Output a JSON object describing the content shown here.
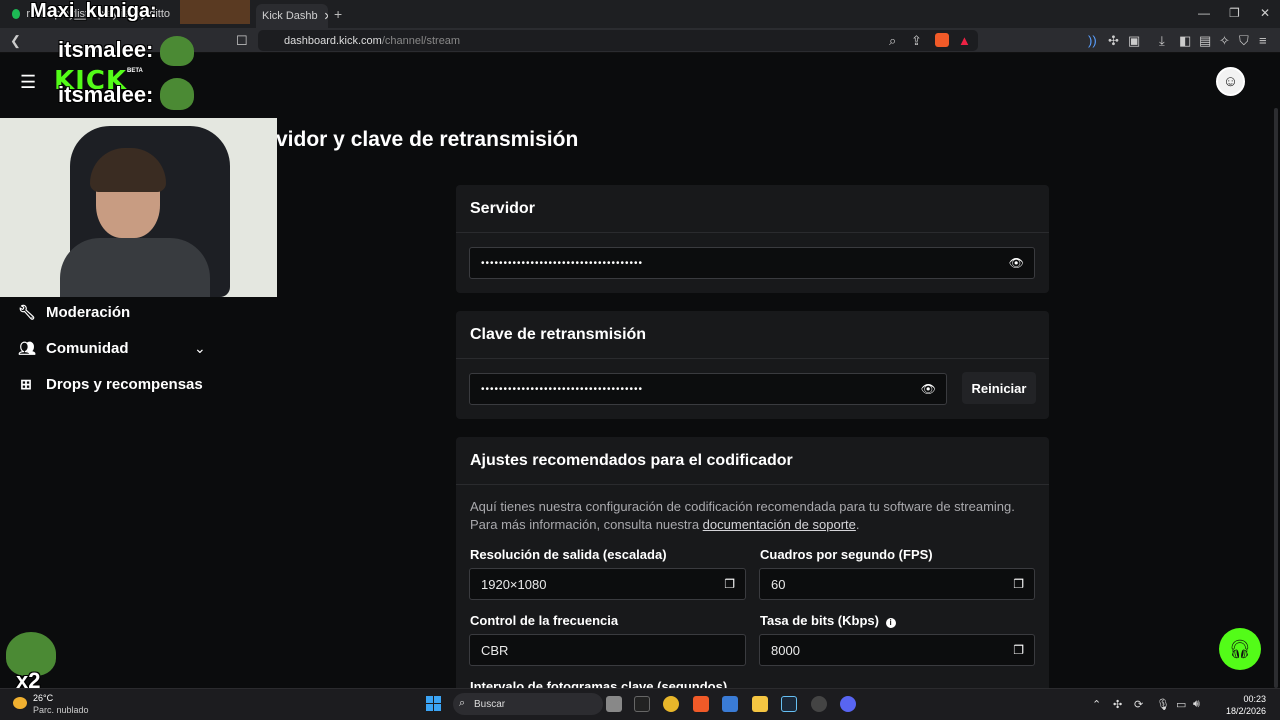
{
  "browser": {
    "tabs": [
      {
        "label": "room playlist · playlist by ditto",
        "active": false
      },
      {
        "label": "Kick Dashb",
        "active": true
      }
    ],
    "new_tab_label": "+",
    "url_domain": "dashboard.kick.com",
    "url_path": "/channel/stream"
  },
  "site": {
    "logo_text": "KICK",
    "logo_beta": "BETA"
  },
  "page": {
    "title": "vidor y clave de retransmisión"
  },
  "sidebar": {
    "items": [
      {
        "label": "Moderación",
        "icon": "wrench-icon"
      },
      {
        "label": "Comunidad",
        "icon": "community-icon"
      },
      {
        "label": "Drops y recompensas",
        "icon": "gift-icon"
      }
    ]
  },
  "server_card": {
    "title": "Servidor",
    "masked_value": "••••••••••••••••••••••••••••••••••••"
  },
  "key_card": {
    "title": "Clave de retransmisión",
    "masked_value": "••••••••••••••••••••••••••••••••••••",
    "reset_label": "Reiniciar"
  },
  "encoder_card": {
    "title": "Ajustes recomendados para el codificador",
    "description_line1": "Aquí tienes nuestra configuración de codificación recomendada para tu software de streaming.",
    "description_line2_prefix": "Para más información, consulta nuestra ",
    "description_link": "documentación de soporte",
    "description_line2_suffix": ".",
    "fields": [
      {
        "label": "Resolución de salida (escalada)",
        "value": "1920×1080"
      },
      {
        "label": "Cuadros por segundo (FPS)",
        "value": "60"
      },
      {
        "label": "Control de la frecuencia",
        "value": "CBR"
      },
      {
        "label": "Tasa de bits (Kbps)",
        "value": "8000"
      }
    ],
    "cutoff_label": "Intervalo de fotogramas clave (segundos)"
  },
  "overlay": {
    "chat_name": "Maxi_kuniga:",
    "chat_user1": "itsmalee:",
    "chat_user2": "itsmalee:",
    "multiplier": "x2"
  },
  "taskbar": {
    "weather_temp": "26°C",
    "weather_desc": "Parc. nublado",
    "search_label": "Buscar",
    "time": "00:23",
    "date": "18/2/2026"
  },
  "colors": {
    "kick_green": "#53fc18",
    "background": "#0b0c0d",
    "card": "#18191b"
  }
}
